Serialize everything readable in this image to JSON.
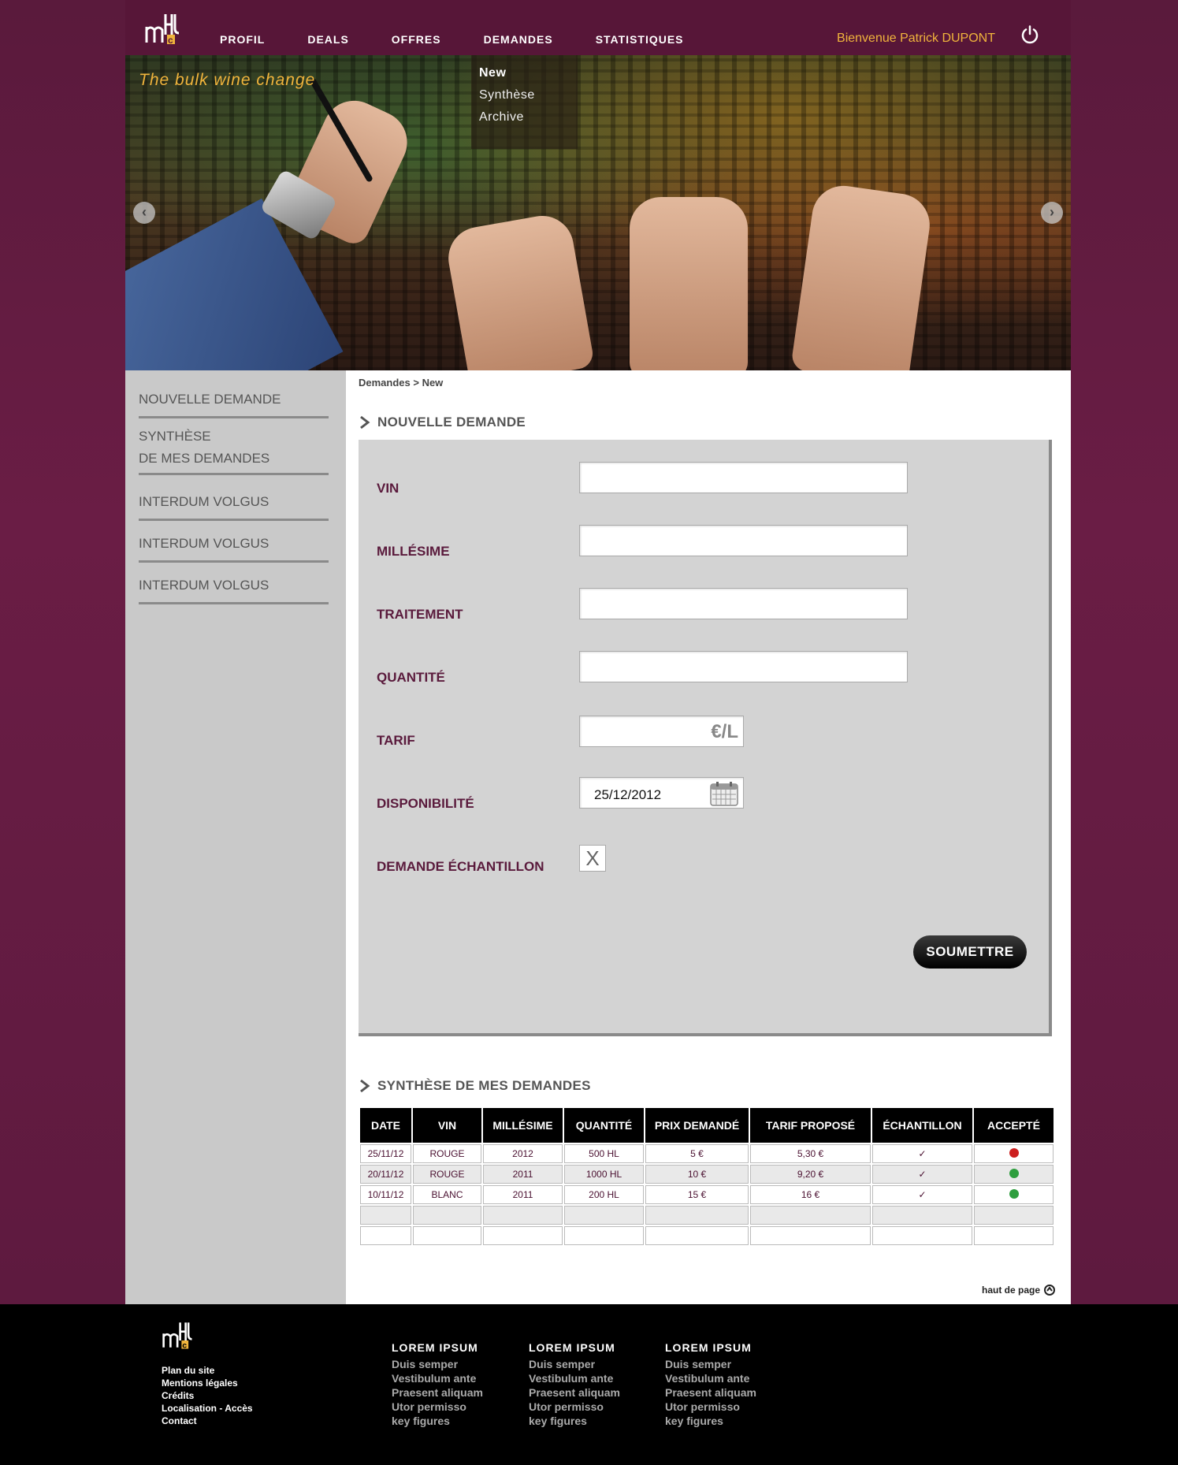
{
  "header": {
    "nav": [
      "PROFIL",
      "DEALS",
      "OFFRES",
      "DEMANDES",
      "STATISTIQUES"
    ],
    "welcome": "Bienvenue Patrick DUPONT"
  },
  "hero": {
    "tagline": "The bulk wine change",
    "dropdown": [
      "New",
      "Synthèse",
      "Archive"
    ]
  },
  "sidebar": {
    "items": [
      "NOUVELLE DEMANDE",
      "SYNTHÈSE",
      "DE MES DEMANDES",
      "INTERDUM VOLGUS",
      "INTERDUM VOLGUS",
      "INTERDUM VOLGUS"
    ]
  },
  "breadcrumb": "Demandes > New",
  "form": {
    "title": "NOUVELLE DEMANDE",
    "labels": {
      "vin": "VIN",
      "millesime": "MILLÉSIME",
      "traitement": "TRAITEMENT",
      "quantite": "QUANTITÉ",
      "tarif": "TARIF",
      "disponibilite": "DISPONIBILITÉ",
      "echantillon": "DEMANDE ÉCHANTILLON"
    },
    "tarif_unit": "€/L",
    "disponibilite_value": "25/12/2012",
    "echantillon_checked": "X",
    "submit": "SOUMETTRE"
  },
  "synthese": {
    "title": "SYNTHÈSE DE MES DEMANDES",
    "columns": [
      "DATE",
      "VIN",
      "MILLÉSIME",
      "QUANTITÉ",
      "PRIX DEMANDÉ",
      "TARIF PROPOSÉ",
      "ÉCHANTILLON",
      "ACCEPTÉ"
    ],
    "rows": [
      {
        "date": "25/11/12",
        "vin": "ROUGE",
        "millesime": "2012",
        "quantite": "500 HL",
        "prix": "5 €",
        "tarif": "5,30 €",
        "echantillon": "✓",
        "accepte_color": "#cc1f1f"
      },
      {
        "date": "20/11/12",
        "vin": "ROUGE",
        "millesime": "2011",
        "quantite": "1000 HL",
        "prix": "10 €",
        "tarif": "9,20 €",
        "echantillon": "✓",
        "accepte_color": "#2e9e3e"
      },
      {
        "date": "10/11/12",
        "vin": "BLANC",
        "millesime": "2011",
        "quantite": "200 HL",
        "prix": "15 €",
        "tarif": "16 €",
        "echantillon": "✓",
        "accepte_color": "#2e9e3e"
      }
    ]
  },
  "top_link": "haut de page",
  "footer": {
    "links": [
      "Plan du site",
      "Mentions légales",
      "Crédits",
      "Localisation - Accès",
      "Contact"
    ],
    "columns": [
      {
        "title": "LOREM IPSUM",
        "items": [
          "Duis semper",
          "Vestibulum ante",
          "Praesent aliquam",
          "Utor permisso",
          "key figures"
        ]
      },
      {
        "title": "LOREM IPSUM",
        "items": [
          "Duis semper",
          "Vestibulum ante",
          "Praesent aliquam",
          "Utor permisso",
          "key figures"
        ]
      },
      {
        "title": "LOREM IPSUM",
        "items": [
          "Duis semper",
          "Vestibulum ante",
          "Praesent aliquam",
          "Utor permisso",
          "key figures"
        ]
      }
    ]
  },
  "colors": {
    "brand": "#5a1a3c",
    "accent": "#f0b43c"
  }
}
